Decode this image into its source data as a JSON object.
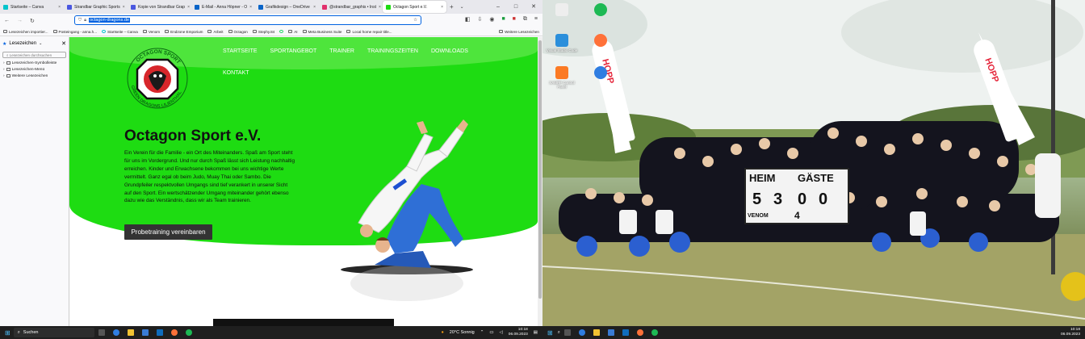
{
  "browser": {
    "tabs": [
      {
        "label": "Startseite – Canva",
        "color": "#00c4cc"
      },
      {
        "label": "Strandbar Graphic Sports",
        "color": "#4a57e0"
      },
      {
        "label": "Kopie von Strandbar Grap",
        "color": "#4a57e0"
      },
      {
        "label": "E-Mail - Anna Höpner - O",
        "color": "#0a64c8"
      },
      {
        "label": "Grafikdesign – OneDrive",
        "color": "#0a64c8"
      },
      {
        "label": "@strandbar_graphis • Inst",
        "color": "#e1306c"
      },
      {
        "label": "Octagon Sport e.V.",
        "color": "#1edc12"
      }
    ],
    "url": "octagon-dragons.de",
    "bookmarks": [
      "Lesezeichen importier...",
      "Posteingang - anna.h...",
      "Startseite – Canva",
      "Venom",
      "Endzone Emporium",
      "Arbeit",
      "Octagon",
      "Stephy.84",
      "AI",
      "Meta Business Suite",
      "Local home repair title..."
    ],
    "bookmarks_more": "Weitere Lesezeichen"
  },
  "sidebar": {
    "title": "Lesezeichen",
    "search_placeholder": "Lesezeichen durchsuchen",
    "items": [
      {
        "label": "Lesezeichen-Symbolleiste"
      },
      {
        "label": "Lesezeichen-Menü"
      },
      {
        "label": "Weitere Lesezeichen"
      }
    ]
  },
  "site": {
    "logo_text": "OCTAGON SPORT · GREEN DRAGONS LILIENTHAL",
    "menu": [
      "STARTSEITE",
      "SPORTANGEBOT",
      "TRAINER",
      "TRAININGSZEITEN",
      "DOWNLOADS"
    ],
    "menu_second_row": "KONTAKT",
    "headline": "Octagon Sport e.V.",
    "lead": "Ein Verein für die Familie - ein Ort des Miteinanders. Spaß am Sport steht für uns im Vordergrund. Und nur durch Spaß lässt sich Leistung nachhaltig erreichen. Kinder und Erwachsene bekommen bei uns wichtige Werte vermittelt. Ganz egal ob beim Judo, Muay Thai oder Sambo. Die Grundpfeiler respektvollen Umgangs sind tief verankert in unserer Sicht auf den Sport. Ein wertschätzender Umgang miteinander gehört ebenso dazu wie das Verständnis, dass wir als Team trainieren.",
    "cta": "Probetraining vereinbaren",
    "accent": "#1edc12"
  },
  "desktop": {
    "icons": [
      {
        "label": "",
        "color": "#eeeeee"
      },
      {
        "label": "",
        "color": "#1db954"
      },
      {
        "label": "Visual Studio Code",
        "color": "#2b8fdb"
      },
      {
        "label": "",
        "color": "#ff7139"
      },
      {
        "label": "XAMPP Control Panel",
        "color": "#fb7a24"
      },
      {
        "label": "",
        "color": "#2f7de1"
      }
    ],
    "scoreboard": {
      "heim": "HEIM",
      "gaeste": "GÄSTE",
      "digits": [
        "5",
        "3",
        "0",
        "0"
      ],
      "sponsor": "VENOM",
      "extra": "4"
    },
    "banner_text": "HOPP"
  },
  "taskbar": {
    "search_label": "Suchen",
    "weather": "20°C Sonnig",
    "time": "10:18",
    "date": "06.09.2023"
  },
  "taskbar2": {
    "time": "10:18",
    "date": "06.09.2023"
  }
}
